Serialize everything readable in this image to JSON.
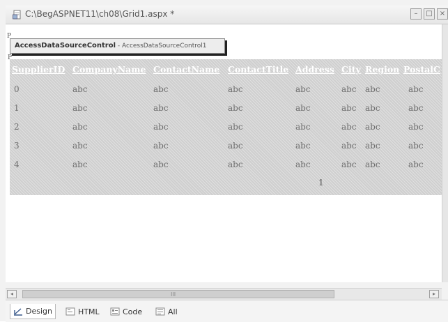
{
  "window": {
    "title": "C:\\BegASPNET11\\ch08\\Grid1.aspx *",
    "buttons": [
      "–",
      "□",
      "×"
    ]
  },
  "designer": {
    "marker": "P",
    "datasource": {
      "title": "AccessDataSourceControl",
      "subtitle": " - AccessDataSourceControl1"
    },
    "grid": {
      "headers": [
        "SupplierID",
        "CompanyName",
        "ContactName",
        "ContactTitle",
        "Address",
        "City",
        "Region",
        "PostalC"
      ],
      "rows": [
        [
          "0",
          "abc",
          "abc",
          "abc",
          "abc",
          "abc",
          "abc",
          "abc"
        ],
        [
          "1",
          "abc",
          "abc",
          "abc",
          "abc",
          "abc",
          "abc",
          "abc"
        ],
        [
          "2",
          "abc",
          "abc",
          "abc",
          "abc",
          "abc",
          "abc",
          "abc"
        ],
        [
          "3",
          "abc",
          "abc",
          "abc",
          "abc",
          "abc",
          "abc",
          "abc"
        ],
        [
          "4",
          "abc",
          "abc",
          "abc",
          "abc",
          "abc",
          "abc",
          "abc"
        ]
      ],
      "pager": "1"
    }
  },
  "scrollbar": {
    "grip": "III"
  },
  "tabs": [
    {
      "label": "Design",
      "icon": "design-icon",
      "active": true
    },
    {
      "label": "HTML",
      "icon": "html-icon",
      "active": false
    },
    {
      "label": "Code",
      "icon": "code-icon",
      "active": false
    },
    {
      "label": "All",
      "icon": "all-icon",
      "active": false
    }
  ],
  "colors": {
    "grid_background": "#cfcfcf",
    "header_text": "#ffffff"
  }
}
